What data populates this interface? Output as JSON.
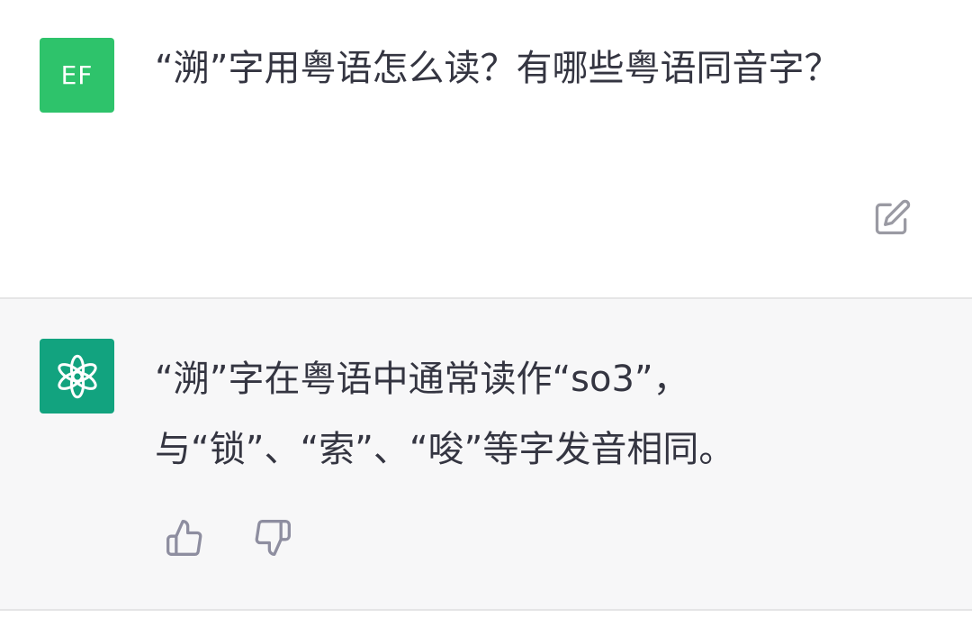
{
  "user_message": {
    "avatar_initials": "EF",
    "avatar_color": "#2ec36b",
    "text": "“溯”字用粤语怎么读？有哪些粤语同音字？",
    "edit_icon": "edit-icon"
  },
  "assistant_message": {
    "avatar_icon": "openai-logo-icon",
    "avatar_color": "#12a37f",
    "text": "“溯”字在粤语中通常读作“so3”，与“锁”、“索”、“唆”等字发音相同。",
    "thumbs_up_icon": "thumbs-up-icon",
    "thumbs_down_icon": "thumbs-down-icon"
  }
}
